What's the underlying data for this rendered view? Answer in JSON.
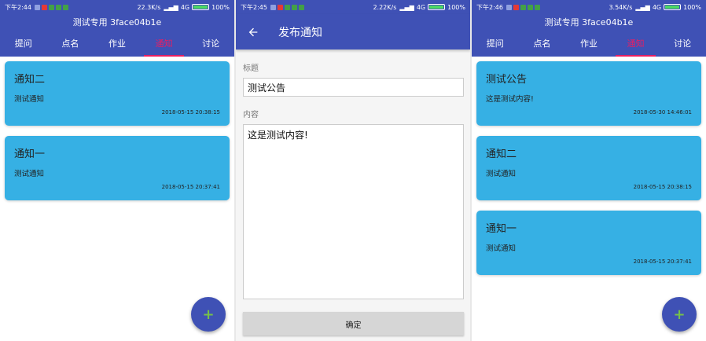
{
  "colors": {
    "primary": "#3f51b5",
    "accent": "#e91e63",
    "card": "#36b0e4",
    "fab_plus": "#76c14a"
  },
  "screen1": {
    "status": {
      "time": "下午2:44",
      "speed": "22.3K/s",
      "network": "4G",
      "battery": "100%"
    },
    "title": "测试专用 3face04b1e",
    "tabs": [
      "提问",
      "点名",
      "作业",
      "通知",
      "讨论"
    ],
    "active_tab": "通知",
    "notices": [
      {
        "title": "通知二",
        "body": "测试通知",
        "time": "2018-05-15 20:38:15"
      },
      {
        "title": "通知一",
        "body": "测试通知",
        "time": "2018-05-15 20:37:41"
      }
    ],
    "fab": {
      "icon": "plus-icon",
      "label": "+"
    }
  },
  "screen2": {
    "status": {
      "time": "下午2:45",
      "speed": "2.22K/s",
      "network": "4G",
      "battery": "100%"
    },
    "toolbar_title": "发布通知",
    "back_icon": "arrow-back-icon",
    "title_label": "标题",
    "title_value": "测试公告",
    "content_label": "内容",
    "content_value": "这是测试内容!",
    "confirm_label": "确定"
  },
  "screen3": {
    "status": {
      "time": "下午2:46",
      "speed": "3.54K/s",
      "network": "4G",
      "battery": "100%"
    },
    "title": "测试专用 3face04b1e",
    "tabs": [
      "提问",
      "点名",
      "作业",
      "通知",
      "讨论"
    ],
    "active_tab": "通知",
    "notices": [
      {
        "title": "测试公告",
        "body": "这是测试内容!",
        "time": "2018-05-30 14:46:01"
      },
      {
        "title": "通知二",
        "body": "测试通知",
        "time": "2018-05-15 20:38:15"
      },
      {
        "title": "通知一",
        "body": "测试通知",
        "time": "2018-05-15 20:37:41"
      }
    ],
    "fab": {
      "icon": "plus-icon",
      "label": "+"
    }
  }
}
